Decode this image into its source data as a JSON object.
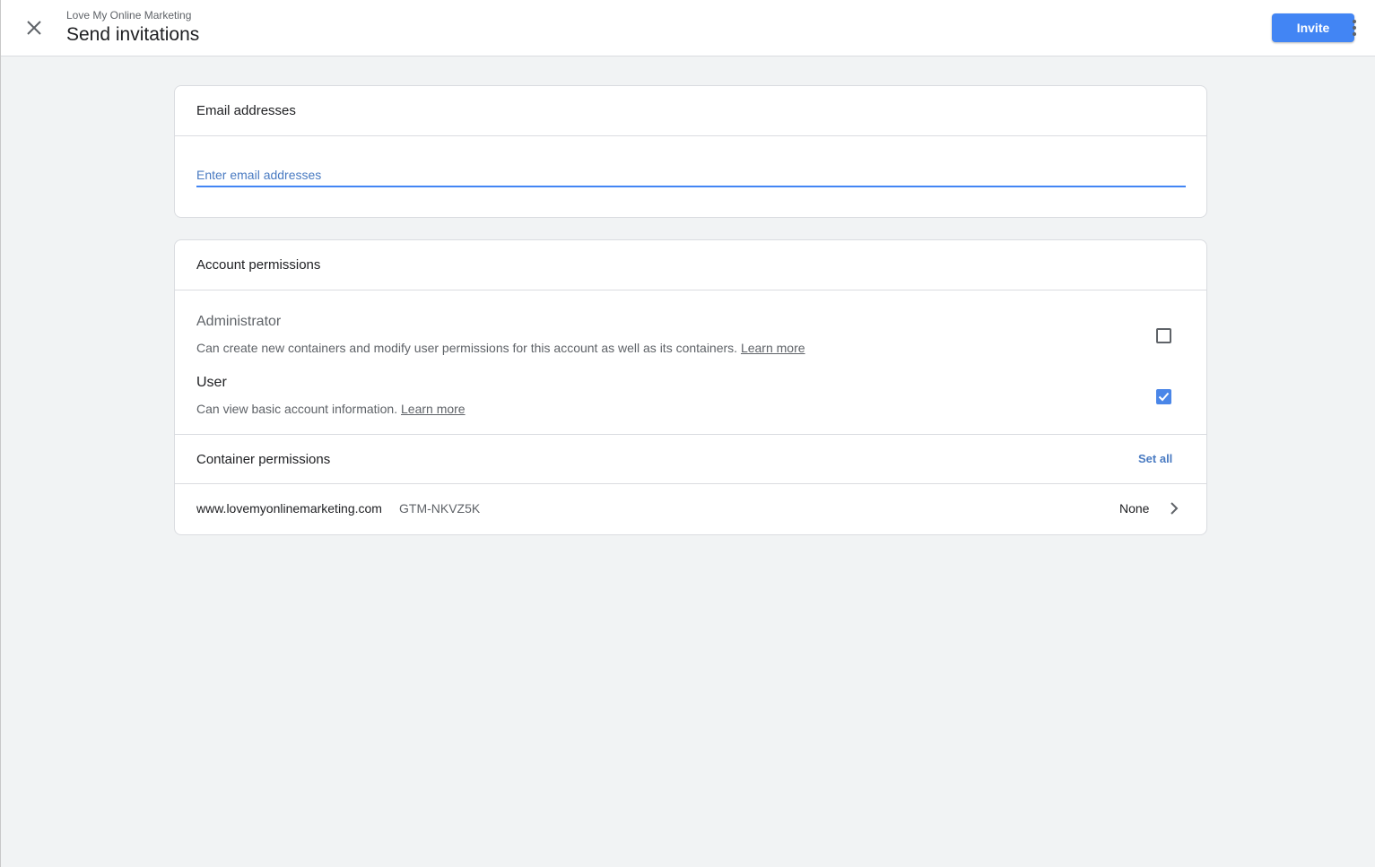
{
  "header": {
    "account_name": "Love My Online Marketing",
    "title": "Send invitations",
    "invite_label": "Invite"
  },
  "email_section": {
    "heading": "Email addresses",
    "placeholder": "Enter email addresses",
    "value": ""
  },
  "permissions": {
    "heading": "Account permissions",
    "roles": [
      {
        "name": "Administrator",
        "description": "Can create new containers and modify user permissions for this account as well as its containers.",
        "link": "Learn more",
        "checked": false
      },
      {
        "name": "User",
        "description": "Can view basic account information.",
        "link": "Learn more",
        "checked": true
      }
    ],
    "container_heading": "Container permissions",
    "set_all_label": "Set all",
    "containers": [
      {
        "domain": "www.lovemyonlinemarketing.com",
        "id": "GTM-NKVZ5K",
        "permission": "None"
      }
    ]
  },
  "colors": {
    "accent": "#4285f4",
    "link_blue": "#4a7bc2",
    "checkbox_blue": "#4a86e8",
    "background": "#f1f3f4"
  },
  "icons": {
    "close": "close-icon",
    "more": "more-vert-icon",
    "chevron": "chevron-right-icon",
    "check": "check-icon"
  }
}
